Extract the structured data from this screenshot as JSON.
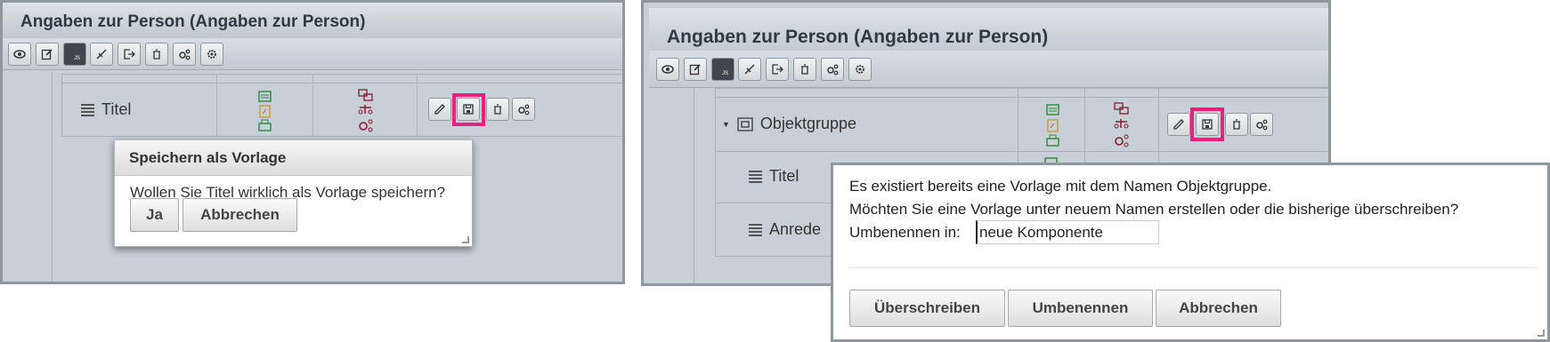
{
  "left_panel": {
    "title": "Angaben zur Person (Angaben zur Person)",
    "row_label": "Titel"
  },
  "left_dialog": {
    "title": "Speichern als Vorlage",
    "message": "Wollen Sie Titel wirklich als Vorlage speichern?",
    "yes_label": "Ja",
    "cancel_label": "Abbrechen"
  },
  "right_panel": {
    "title": "Angaben zur Person (Angaben zur Person)",
    "rows": [
      "Objektgruppe",
      "Titel",
      "Anrede"
    ]
  },
  "right_dialog": {
    "line1": "Es existiert bereits eine Vorlage mit dem Namen Objektgruppe.",
    "line2": "Möchten Sie eine Vorlage unter neuem Namen erstellen oder die bisherige überschreiben?",
    "rename_label": "Umbenennen in:",
    "rename_value": "neue Komponente",
    "overwrite_label": "Überschreiben",
    "rename_button": "Umbenennen",
    "cancel_label": "Abbrechen"
  },
  "colors": {
    "highlight": "#e8237e",
    "panel_bg": "#c7d0d6"
  },
  "icons": [
    "eye-icon",
    "edit-icon",
    "js-icon",
    "collapse-icon",
    "export-icon",
    "trash-icon",
    "settings-multi-icon",
    "gear-icon"
  ]
}
